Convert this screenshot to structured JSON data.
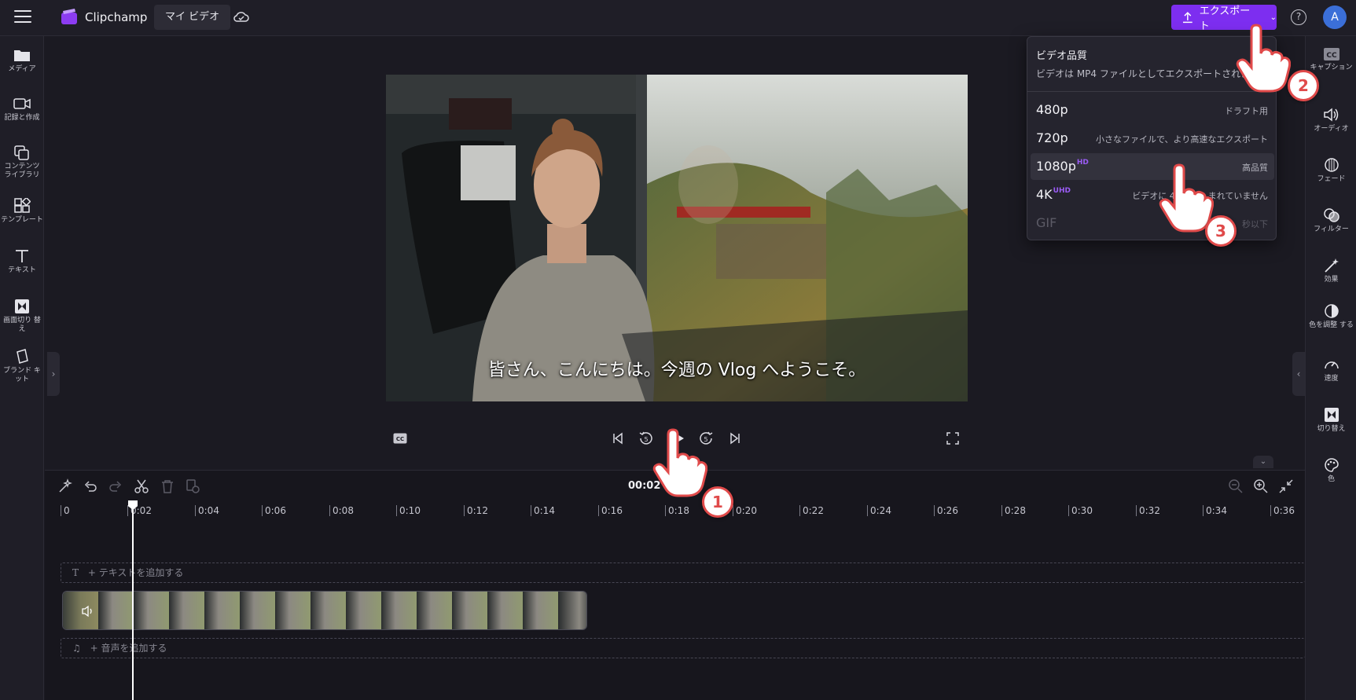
{
  "header": {
    "app_name": "Clipchamp",
    "my_video_label": "マイ ビデオ",
    "export_label": "エクスポート",
    "help_label": "?",
    "avatar_initial": "A"
  },
  "left_sidebar": {
    "items": [
      {
        "label": "メディア",
        "icon": "folder-icon"
      },
      {
        "label": "記録と作成",
        "icon": "camera-icon"
      },
      {
        "label": "コンテンツ ライブラリ",
        "icon": "library-icon"
      },
      {
        "label": "テンプレート",
        "icon": "template-icon"
      },
      {
        "label": "テキスト",
        "icon": "text-icon"
      },
      {
        "label": "画面切り 替え",
        "icon": "transition-icon"
      },
      {
        "label": "ブランド キット",
        "icon": "brand-kit-icon"
      }
    ]
  },
  "right_sidebar": {
    "items": [
      {
        "label": "キャプション",
        "icon": "cc-icon"
      },
      {
        "label": "オーディオ",
        "icon": "speaker-icon"
      },
      {
        "label": "フェード",
        "icon": "fade-icon"
      },
      {
        "label": "フィルター",
        "icon": "filter-icon"
      },
      {
        "label": "効果",
        "icon": "magic-wand-icon"
      },
      {
        "label": "色を調整 する",
        "icon": "contrast-icon"
      },
      {
        "label": "速度",
        "icon": "speedometer-icon"
      },
      {
        "label": "切り替え",
        "icon": "transition-icon"
      },
      {
        "label": "色",
        "icon": "palette-icon"
      }
    ]
  },
  "preview": {
    "subtitle": "皆さん、こんにちは。今週の Vlog へようこそ。"
  },
  "timeline": {
    "current_time": "00:02",
    "ruler_labels": [
      "0",
      "0:02",
      "0:04",
      "0:06",
      "0:08",
      "0:10",
      "0:12",
      "0:14",
      "0:16",
      "0:18",
      "0:20",
      "0:22",
      "0:24",
      "0:26",
      "0:28",
      "0:30",
      "0:32",
      "0:34",
      "0:36"
    ],
    "add_text_label": "+ テキストを追加する",
    "add_audio_label": "+ 音声を追加する"
  },
  "export_menu": {
    "title": "ビデオ品質",
    "subtitle": "ビデオは MP4 ファイルとしてエクスポートされます",
    "options": [
      {
        "resolution": "480p",
        "badge": "",
        "description": "ドラフト用",
        "selected": false,
        "disabled": false
      },
      {
        "resolution": "720p",
        "badge": "",
        "description": "小さなファイルで、より高速なエクスポート",
        "selected": false,
        "disabled": false
      },
      {
        "resolution": "1080p",
        "badge": "HD",
        "description": "高品質",
        "selected": true,
        "disabled": false
      },
      {
        "resolution": "4K",
        "badge": "UHD",
        "description": "ビデオに 4K ×　　まれていません",
        "selected": false,
        "disabled": false
      },
      {
        "resolution": "GIF",
        "badge": "",
        "description": "秒以下",
        "selected": false,
        "disabled": true
      }
    ]
  },
  "steps": [
    "1",
    "2",
    "3"
  ],
  "colors": {
    "accent": "#7d2ef0",
    "badge": "#9b5cf6",
    "step_ring": "#e04a4a"
  }
}
